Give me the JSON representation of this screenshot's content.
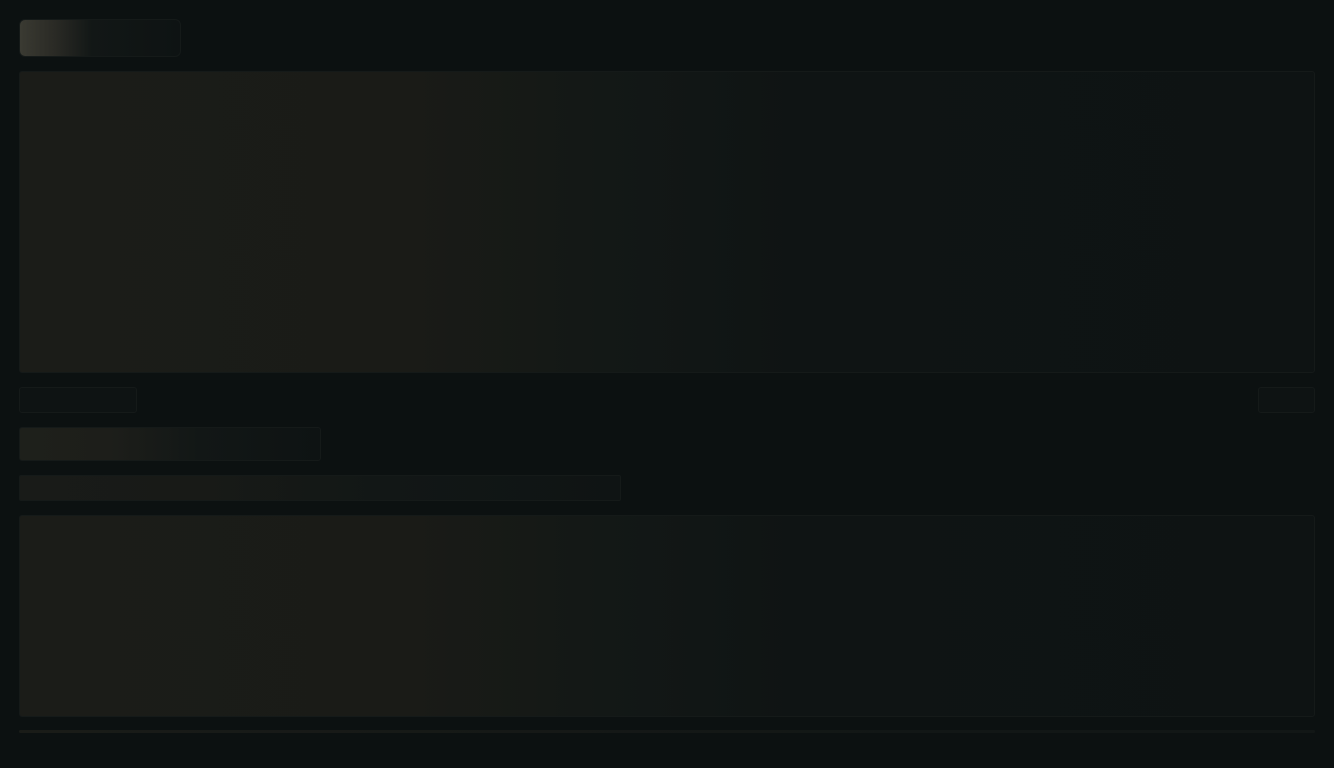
{
  "page": {
    "state": "loading",
    "background": "#0c1111",
    "accent_shimmer": "#3a3a32"
  }
}
